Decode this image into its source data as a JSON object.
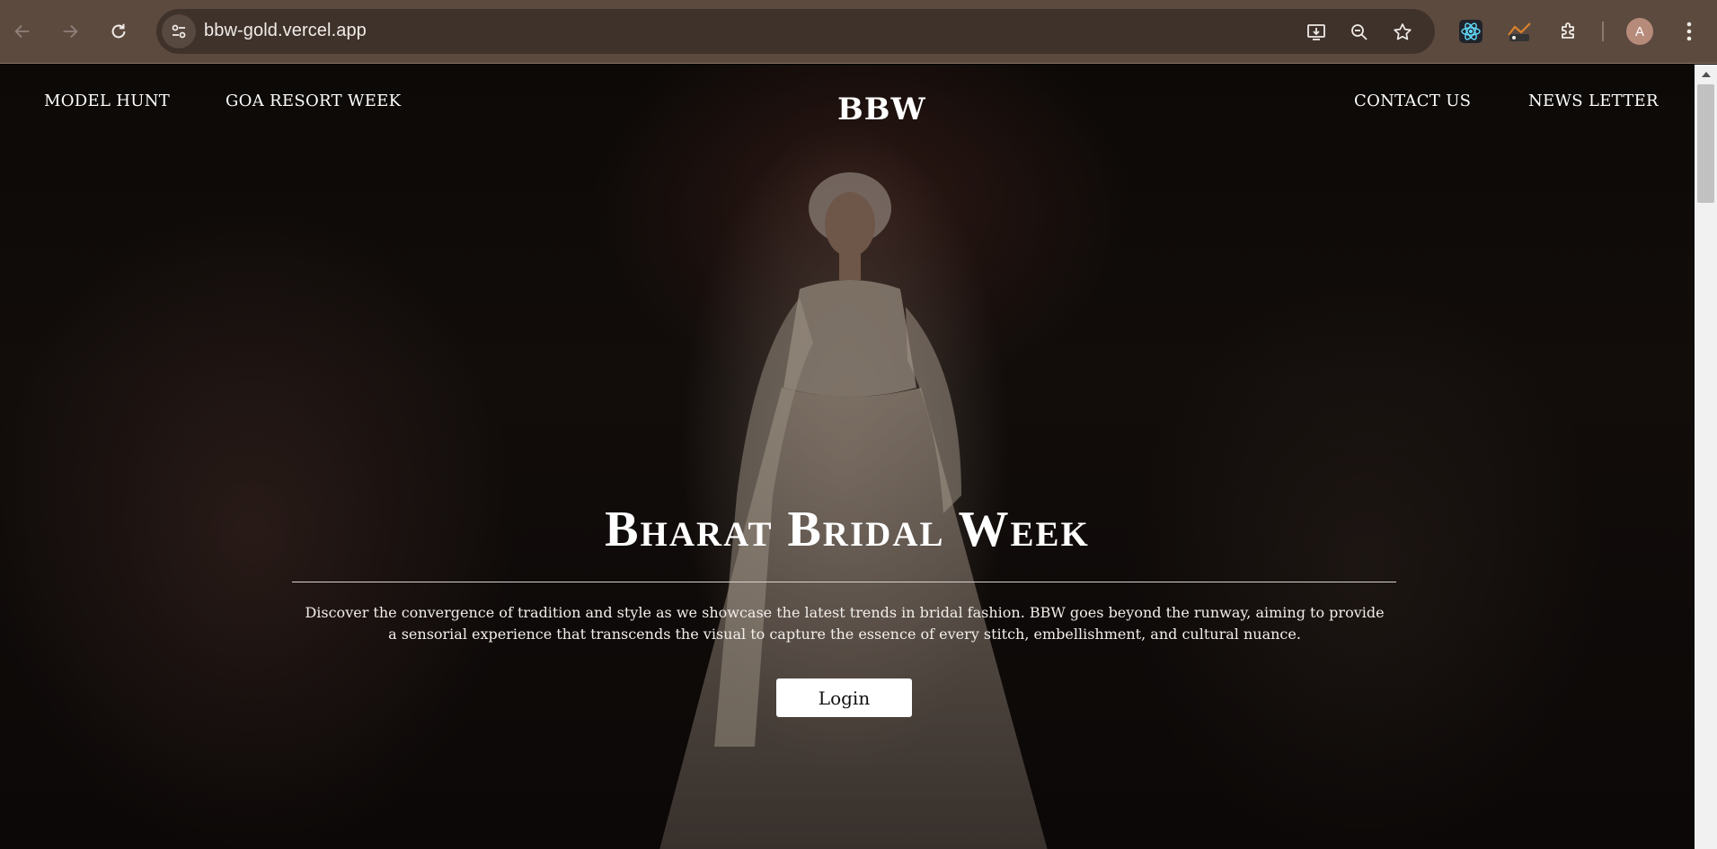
{
  "browser": {
    "url": "bbw-gold.vercel.app",
    "avatar_letter": "A",
    "icons": {
      "back": "arrow-left-icon",
      "forward": "arrow-right-icon",
      "reload": "reload-icon",
      "site_info": "tune-icon",
      "install": "install-app-icon",
      "zoom": "zoom-icon",
      "bookmark": "star-icon",
      "ext_react": "react-devtools-icon",
      "ext_second": "extension-icon",
      "extensions": "puzzle-icon",
      "menu": "kebab-menu-icon"
    }
  },
  "site": {
    "nav_left": [
      "MODEL HUNT",
      "GOA RESORT WEEK"
    ],
    "logo": "BBW",
    "nav_right": [
      "CONTACT US",
      "NEWS LETTER"
    ]
  },
  "hero": {
    "title": "Bharat Bridal Week",
    "description": "Discover the convergence of tradition and style as we showcase the latest trends in bridal fashion. BBW goes beyond the runway, aiming to provide a sensorial experience that transcends the visual to capture the essence of every stitch, embellishment, and cultural nuance.",
    "login_label": "Login"
  },
  "colors": {
    "chrome": "#5c4a3f",
    "omnibox": "#3f322b",
    "page_bg": "#0a0807",
    "text": "#ffffff",
    "button_bg": "#ffffff"
  }
}
